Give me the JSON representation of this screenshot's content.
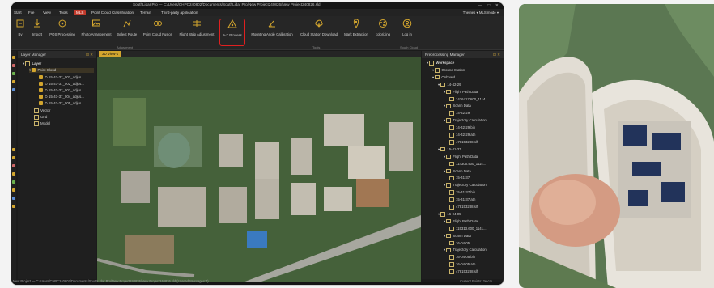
{
  "window": {
    "title": "SouthLidar Pro — C:/Users/CHPC240802/Documents/SouthLidar Pro/New Project240826/New Project240826.sld",
    "controls": [
      "—",
      "□",
      "✕"
    ]
  },
  "menu": {
    "items": [
      {
        "label": "Start"
      },
      {
        "label": "File"
      },
      {
        "label": "View"
      },
      {
        "label": "Tools"
      },
      {
        "label": "MLS",
        "active": true
      },
      {
        "label": "Point Cloud Classification"
      },
      {
        "label": "Terrain"
      },
      {
        "label": "Third-party application"
      }
    ],
    "right": "Themes ▾  MLS mode ▾"
  },
  "ribbon": {
    "tools": [
      {
        "label": "By",
        "icon": "by-icon"
      },
      {
        "label": "Import",
        "icon": "import-icon"
      },
      {
        "label": "POS Processing",
        "icon": "pos-processing-icon"
      },
      {
        "label": "Photo Arrangement",
        "icon": "photo-arrangement-icon"
      },
      {
        "label": "Select Route",
        "icon": "select-route-icon"
      },
      {
        "label": "Point Cloud Fusion",
        "icon": "point-cloud-fusion-icon"
      },
      {
        "label": "Flight Strip Adjustment",
        "icon": "flight-strip-icon"
      },
      {
        "label": "A-T Process",
        "icon": "at-process-icon",
        "highlight": true
      },
      {
        "label": "Mounting Angle Calibration",
        "icon": "mounting-angle-icon"
      },
      {
        "label": "Cloud Station Download",
        "icon": "cloud-download-icon"
      },
      {
        "label": "Mark Extraction",
        "icon": "mark-extraction-icon"
      },
      {
        "label": "colorizing",
        "icon": "colorizing-icon"
      },
      {
        "label": "Log in",
        "icon": "login-icon"
      }
    ],
    "groups": [
      {
        "label": "Adjustment"
      },
      {
        "label": "Tools"
      },
      {
        "label": "South Cloud"
      }
    ]
  },
  "layer_manager": {
    "title": "Layer Manager",
    "root": "Layer",
    "point_cloud": "Point Cloud",
    "files": [
      "15-41-37_001_adjus...",
      "15-41-37_002_adjus...",
      "15-41-37_003_adjus...",
      "15-41-37_004_adjus...",
      "15-41-37_005_adjus..."
    ],
    "others": [
      "Vector",
      "Grid",
      "Model"
    ]
  },
  "view": {
    "tab": "3D View-1"
  },
  "preprocessing": {
    "title": "Preprocessing Manager",
    "rows": [
      {
        "t": "Workspace",
        "lv": 0,
        "bold": true
      },
      {
        "t": "Ground Station",
        "lv": 1
      },
      {
        "t": "Onboard",
        "lv": 1
      },
      {
        "t": "14-42-29",
        "lv": 2
      },
      {
        "t": "Flight Path Data",
        "lv": 3
      },
      {
        "t": "1436417.600_1114...",
        "lv": 4
      },
      {
        "t": "Scann Data",
        "lv": 3
      },
      {
        "t": "14-42-29",
        "lv": 4
      },
      {
        "t": "Trajectory Calculation",
        "lv": 3
      },
      {
        "t": "14-42-29.bin",
        "lv": 4
      },
      {
        "t": "14-42-29.ath",
        "lv": 4
      },
      {
        "t": "478153288.slh",
        "lv": 4
      },
      {
        "t": "15-41-37",
        "lv": 2
      },
      {
        "t": "Flight Path Data",
        "lv": 3
      },
      {
        "t": "114305.400_1114...",
        "lv": 4
      },
      {
        "t": "Scann Data",
        "lv": 3
      },
      {
        "t": "15-41-37",
        "lv": 4
      },
      {
        "t": "Trajectory Calculation",
        "lv": 3
      },
      {
        "t": "15-41-37.bin",
        "lv": 4
      },
      {
        "t": "15-41-37.ath",
        "lv": 4
      },
      {
        "t": "478153288.slh",
        "lv": 4
      },
      {
        "t": "16-04-05",
        "lv": 2
      },
      {
        "t": "Flight Path Data",
        "lv": 3
      },
      {
        "t": "115313.600_1141...",
        "lv": 4
      },
      {
        "t": "Scann Data",
        "lv": 3
      },
      {
        "t": "16-04-05",
        "lv": 4
      },
      {
        "t": "Trajectory Calculation",
        "lv": 3
      },
      {
        "t": "16-04-05.bin",
        "lv": 4
      },
      {
        "t": "16-04-05.ath",
        "lv": 4
      },
      {
        "t": "478153288.slh",
        "lv": 4
      }
    ]
  },
  "status": {
    "left": "New Project — C:/Users/CHPC240802/Documents/SouthLidar Pro/New Project240826/New Project240826.sld (Unread Messages:7)",
    "right": "Current Points: 2e-cm"
  },
  "colors": {
    "accent": "#d2a52e",
    "highlight": "#e02020",
    "active_menu": "#c0392b"
  }
}
